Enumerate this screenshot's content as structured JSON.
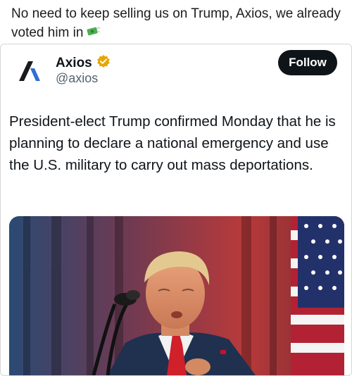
{
  "caption": {
    "text": "No need to keep selling us on Trump, Axios, we already voted him in",
    "emoji_icon": "money-with-wings-icon"
  },
  "post": {
    "account": {
      "name": "Axios",
      "handle": "@axios",
      "verified_badge": "gold-verified-badge-icon",
      "logo_icon": "axios-logo-icon"
    },
    "follow_label": "Follow",
    "text": "President-elect Trump confirmed Monday that he is planning to declare a national emergency and use the U.S. military to carry out mass deportations.",
    "media": {
      "icon": "photo-speaker-at-podium-icon"
    }
  },
  "colors": {
    "follow_bg": "#0f1419",
    "badge": "#e8a500",
    "handle": "#536471"
  }
}
